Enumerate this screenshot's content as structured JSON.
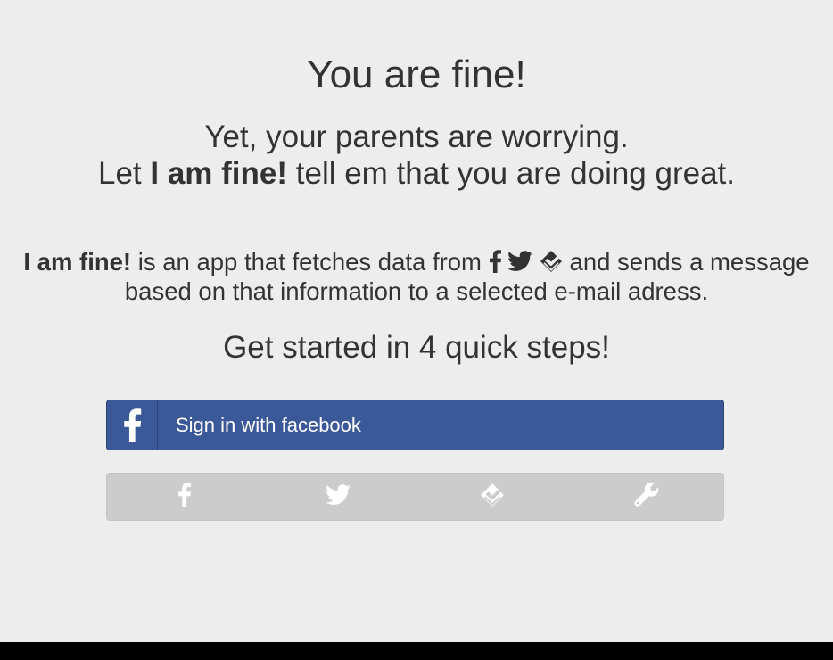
{
  "header": {
    "title": "You are fine!",
    "subtitle_line1": "Yet, your parents are worrying.",
    "subtitle_line2_prefix": "Let ",
    "subtitle_line2_brand": "I am fine!",
    "subtitle_line2_suffix": " tell em that you are doing great."
  },
  "description": {
    "brand": "I am fine!",
    "text_before_icons": " is an app that fetches data from ",
    "text_after_icons": " and sends a message based on that information to a selected e-mail adress.",
    "data_sources": [
      "facebook-icon",
      "twitter-icon",
      "foursquare-icon"
    ]
  },
  "steps": {
    "heading": "Get started in 4 quick steps!",
    "items": [
      {
        "icon": "facebook-icon"
      },
      {
        "icon": "twitter-icon"
      },
      {
        "icon": "foursquare-icon"
      },
      {
        "icon": "wrench-icon"
      }
    ]
  },
  "facebook_button": {
    "label": "Sign in with facebook",
    "icon": "facebook-icon"
  },
  "colors": {
    "background": "#ededed",
    "text": "#333333",
    "facebook_blue": "#3b5998",
    "steps_bar": "#cccccc",
    "step_icon": "#ffffff"
  }
}
